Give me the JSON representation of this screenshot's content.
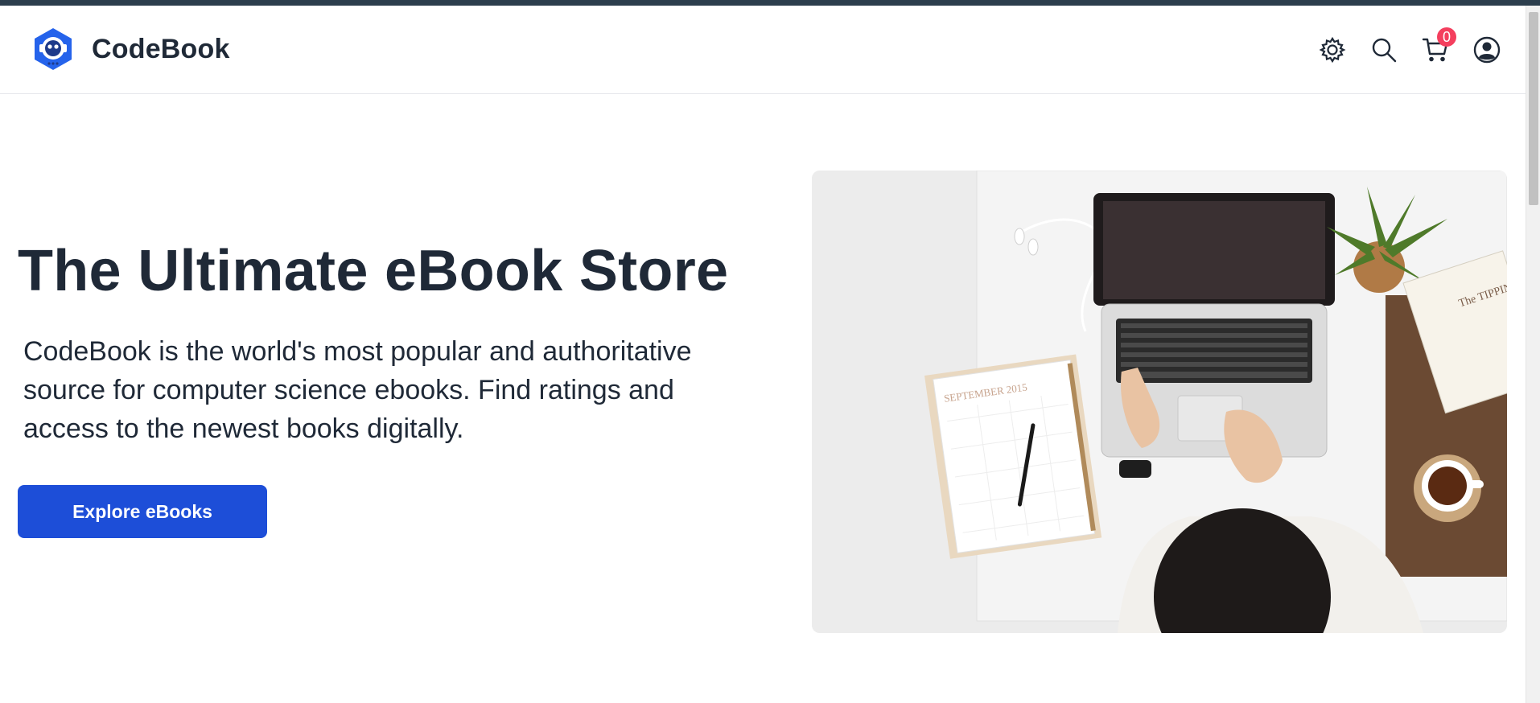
{
  "header": {
    "brand_name": "CodeBook",
    "logo_icon": "robot-head-icon",
    "actions": [
      {
        "name": "settings-icon"
      },
      {
        "name": "search-icon"
      },
      {
        "name": "cart-icon",
        "badge": "0"
      },
      {
        "name": "account-icon"
      }
    ]
  },
  "hero": {
    "title": "The Ultimate eBook Store",
    "description": "CodeBook is the world's most popular and authoritative source for computer science ebooks. Find ratings and access to the newest books digitally.",
    "cta_label": "Explore eBooks",
    "image_notebook_text": "SEPTEMBER 2015",
    "image_book_text": "The TIPPING POINT"
  },
  "colors": {
    "accent": "#1d4ed8",
    "badge": "#f43f5e",
    "text": "#1f2937",
    "top_strip": "#2c3e4d"
  }
}
